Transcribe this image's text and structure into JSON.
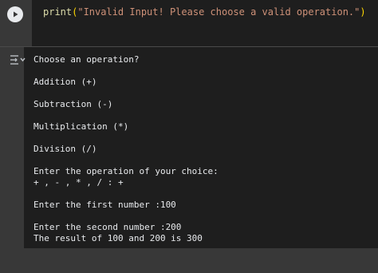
{
  "code": {
    "fn": "print",
    "open": "(",
    "string": "\"Invalid Input! Please choose a valid operation.\"",
    "close": ")"
  },
  "output": {
    "lines": [
      "Choose an operation?",
      "",
      "Addition (+)",
      "",
      "Subtraction (-)",
      "",
      "Multiplication (*)",
      "",
      "Division (/)",
      "",
      "Enter the operation of your choice:",
      "+ , - , * , / : +",
      "",
      "Enter the first number :100",
      "",
      "Enter the second number :200",
      "The result of 100 and 200 is 300"
    ]
  },
  "colors": {
    "background": "#383838",
    "editor_bg": "#1e1e1e",
    "output_bg": "#1e1e1e",
    "text": "#e8eaed",
    "string": "#ce9178",
    "function": "#dcdcaa"
  },
  "icons": {
    "run": "play-icon",
    "output_toggle": "output-toggle-icon"
  }
}
